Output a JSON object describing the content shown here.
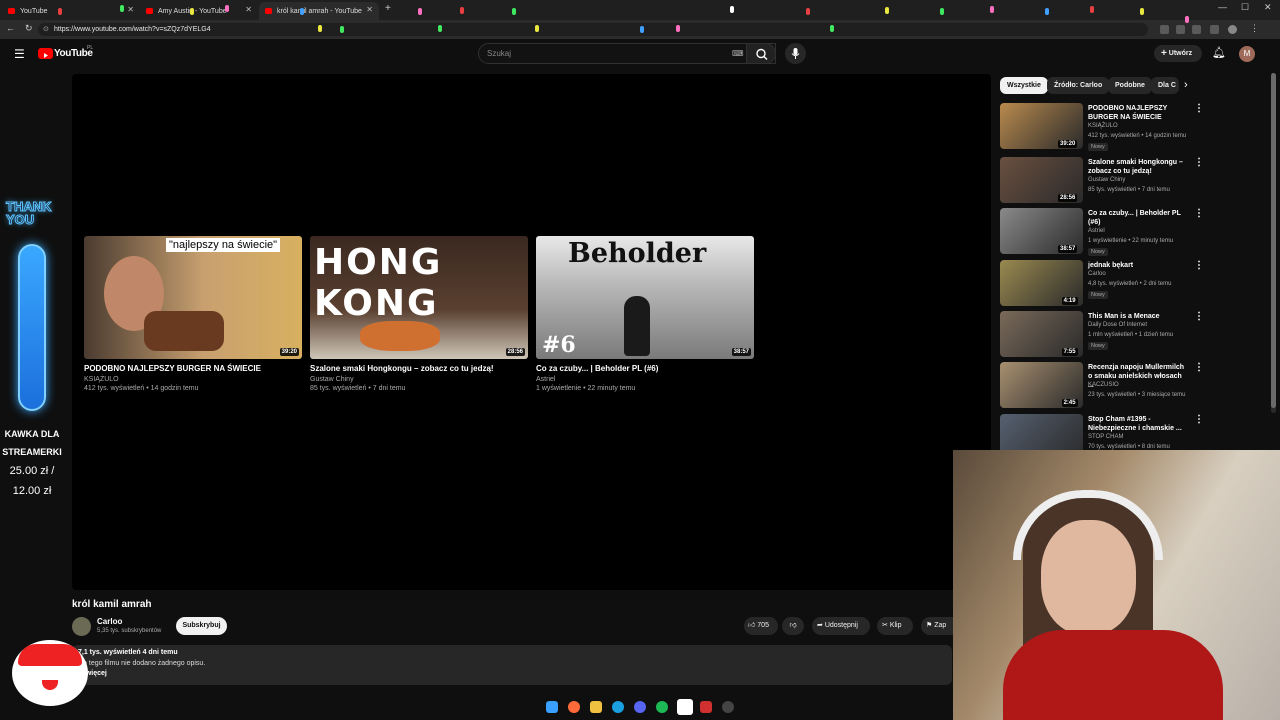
{
  "browser": {
    "tabs": [
      {
        "label": "YouTube",
        "active": false
      },
      {
        "label": "Amy Austin - YouTube",
        "active": false
      },
      {
        "label": "król kamil amrah - YouTube",
        "active": true
      }
    ],
    "new_tab": "+",
    "url": "https://www.youtube.com/watch?v=sZQz7dYELG4"
  },
  "youtube": {
    "logo": "YouTube",
    "logo_region": "PL",
    "search_placeholder": "Szukaj",
    "create_label": "Utwórz",
    "avatar_initial": "M"
  },
  "endscreen": [
    {
      "thumb_text": "\"najlepszy na świecie\"",
      "duration": "39:20",
      "title": "PODOBNO NAJLEPSZY BURGER NA ŚWIECIE",
      "channel": "KSIĄŻULO",
      "meta": "412 tys. wyświetleń • 14 godzin temu"
    },
    {
      "thumb_text": "HONG KONG",
      "duration": "28:56",
      "title": "Szalone smaki Hongkongu – zobacz co tu jedzą!",
      "channel": "Gustaw Chiny",
      "meta": "85 tys. wyświetleń • 7 dni temu"
    },
    {
      "thumb_text": "Beholder",
      "thumb_badge": "#6",
      "duration": "38:57",
      "title": "Co za czuby... | Beholder PL (#6)",
      "channel": "Astriel",
      "meta": "1 wyświetlenie • 22 minuty temu"
    }
  ],
  "video": {
    "title": "król kamil amrah",
    "channel": "Carloo",
    "subscribers": "5,35 tys. subskrybentów",
    "subscribe_label": "Subskrybuj",
    "likes": "705",
    "share_label": "Udostępnij",
    "clip_label": "Klip",
    "save_label": "Zap",
    "views": "7,1 tys. wyświetleń  4 dni temu",
    "description": "Do tego filmu nie dodano żadnego opisu.",
    "more_label": "...więcej"
  },
  "sidebar": {
    "chips": [
      {
        "label": "Wszystkie",
        "selected": true
      },
      {
        "label": "Źródło: Carloo",
        "selected": false
      },
      {
        "label": "Podobne",
        "selected": false
      },
      {
        "label": "Dla C",
        "selected": false
      }
    ],
    "recommendations": [
      {
        "title": "PODOBNO NAJLEPSZY BURGER NA ŚWIECIE",
        "channel": "KSIĄŻULO",
        "meta": "412 tys. wyświetleń • 14 godzin temu",
        "badge": "Nowy",
        "duration": "39:20",
        "thumb_color": "#b98a4e"
      },
      {
        "title": "Szalone smaki Hongkongu – zobacz co tu jedzą!",
        "channel": "Gustaw Chiny",
        "meta": "85 tys. wyświetleń • 7 dni temu",
        "badge": "",
        "duration": "28:56",
        "thumb_color": "#6a5040"
      },
      {
        "title": "Co za czuby... | Beholder PL (#6)",
        "channel": "Astriel",
        "meta": "1 wyświetlenie • 22 minuty temu",
        "badge": "Nowy",
        "duration": "38:57",
        "thumb_color": "#8a8a8a"
      },
      {
        "title": "jednak bękart",
        "channel": "Carloo",
        "meta": "4,8 tys. wyświetleń • 2 dni temu",
        "badge": "Nowy",
        "duration": "4:19",
        "thumb_color": "#9a8a50"
      },
      {
        "title": "This Man is a Menace",
        "channel": "Daily Dose Of Internet",
        "meta": "1 mln wyświetleń • 1 dzień temu",
        "badge": "Nowy",
        "duration": "7:55",
        "thumb_color": "#7a6a5a"
      },
      {
        "title": "Recenzja napoju Mullermilch o smaku anielskich włosach ...",
        "channel": "KACZUSIO",
        "meta": "23 tys. wyświetleń • 3 miesiące temu",
        "badge": "",
        "duration": "2:45",
        "thumb_color": "#a89070"
      },
      {
        "title": "Stop Cham #1395 - Niebezpieczne i chamskie ...",
        "channel": "STOP CHAM",
        "meta": "70 tys. wyświetleń • 8 dni temu",
        "badge": "",
        "duration": "",
        "thumb_color": "#556070"
      }
    ]
  },
  "overlay": {
    "thank_you": "THANK YOU",
    "kawka_line1": "KAWKA DLA",
    "kawka_line2": "STREAMERKI",
    "kawka_amount1": "25.00 zł /",
    "kawka_amount2": "12.00 zł"
  },
  "colors": {
    "yt_red": "#ff0000",
    "bg": "#0f0f0f",
    "chip_bg": "#272727"
  }
}
